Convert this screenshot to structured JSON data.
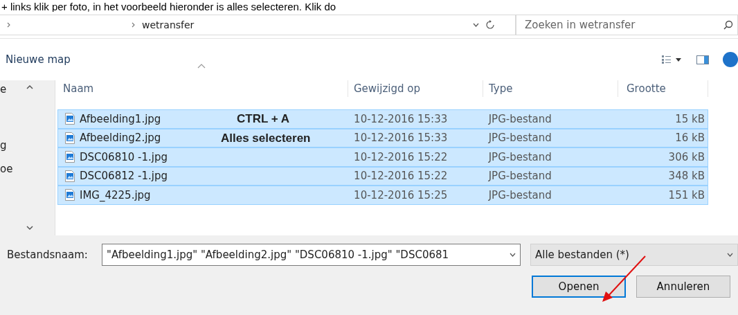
{
  "caption": "+ links klik per foto, in het voorbeeld hieronder is alles selecteren. Klik do",
  "address": {
    "crumbs": [
      "wetransfer"
    ]
  },
  "search": {
    "placeholder": "Zoeken in wetransfer"
  },
  "toolbar": {
    "new_folder": "Nieuwe map"
  },
  "nav_pane": {
    "fragments": [
      "e",
      "g",
      "oe"
    ]
  },
  "columns": [
    {
      "label": "Naam",
      "sorted": true
    },
    {
      "label": "Gewijzigd op",
      "sorted": false
    },
    {
      "label": "Type",
      "sorted": false
    },
    {
      "label": "Grootte",
      "sorted": false
    }
  ],
  "rows": [
    {
      "name": "Afbeelding1.jpg",
      "modified": "10-12-2016 15:33",
      "type": "JPG-bestand",
      "size": "15 kB",
      "selected": true
    },
    {
      "name": "Afbeelding2.jpg",
      "modified": "10-12-2016 15:33",
      "type": "JPG-bestand",
      "size": "16 kB",
      "selected": true
    },
    {
      "name": "DSC06810 -1.jpg",
      "modified": "10-12-2016 15:22",
      "type": "JPG-bestand",
      "size": "306 kB",
      "selected": true
    },
    {
      "name": "DSC06812 -1.jpg",
      "modified": "10-12-2016 15:22",
      "type": "JPG-bestand",
      "size": "348 kB",
      "selected": true
    },
    {
      "name": "IMG_4225.jpg",
      "modified": "10-12-2016 15:25",
      "type": "JPG-bestand",
      "size": "151 kB",
      "selected": true
    }
  ],
  "overlay": [
    "CTRL + A",
    "Alles selecteren"
  ],
  "filename": {
    "label": "Bestandsnaam:",
    "value": "\"Afbeelding1.jpg\" \"Afbeelding2.jpg\" \"DSC06810 -1.jpg\" \"DSC0681"
  },
  "filter": {
    "value": "Alle bestanden (*)"
  },
  "buttons": [
    {
      "label": "Openen",
      "default": true
    },
    {
      "label": "Annuleren",
      "default": false
    }
  ]
}
